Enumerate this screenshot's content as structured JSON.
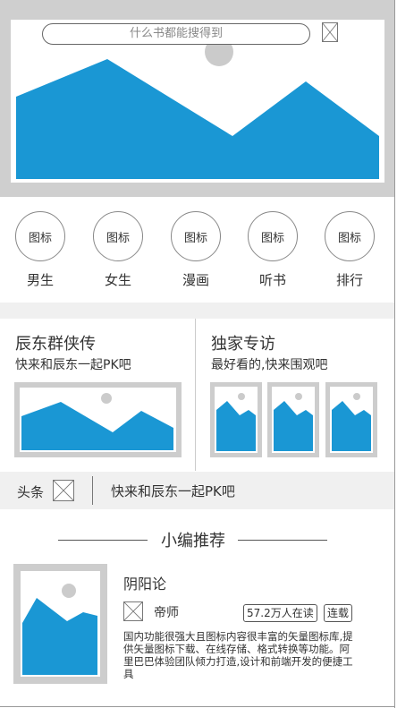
{
  "header": {
    "search_placeholder": "什么书都能搜得到",
    "icons": {
      "search_icon": "image-placeholder-icon",
      "banner": "landscape-image-icon"
    }
  },
  "nav": {
    "icon_text": "图标",
    "items": [
      {
        "label": "男生"
      },
      {
        "label": "女生"
      },
      {
        "label": "漫画"
      },
      {
        "label": "听书"
      },
      {
        "label": "排行"
      }
    ]
  },
  "features": {
    "left": {
      "title": "辰东群侠传",
      "subtitle": "快来和辰东一起PK吧"
    },
    "right": {
      "title": "独家专访",
      "subtitle": "最好看的,快来围观吧"
    }
  },
  "headline": {
    "label": "头条",
    "text": "快来和辰东一起PK吧"
  },
  "recommend": {
    "section_title": "小编推荐",
    "book": {
      "title": "阴阳论",
      "author": "帝师",
      "readers": "57.2万人在读",
      "status": "连载",
      "description": "国内功能很强大且图标内容很丰富的矢量图标库,提供矢量图标下载、在线存储、格式转换等功能。阿里巴巴体验团队倾力打造,设计和前端开发的便捷工具"
    }
  },
  "colors": {
    "accent": "#1a97d4",
    "placeholder_gray": "#cdcdcd",
    "bar_gray": "#f0f0f0"
  }
}
